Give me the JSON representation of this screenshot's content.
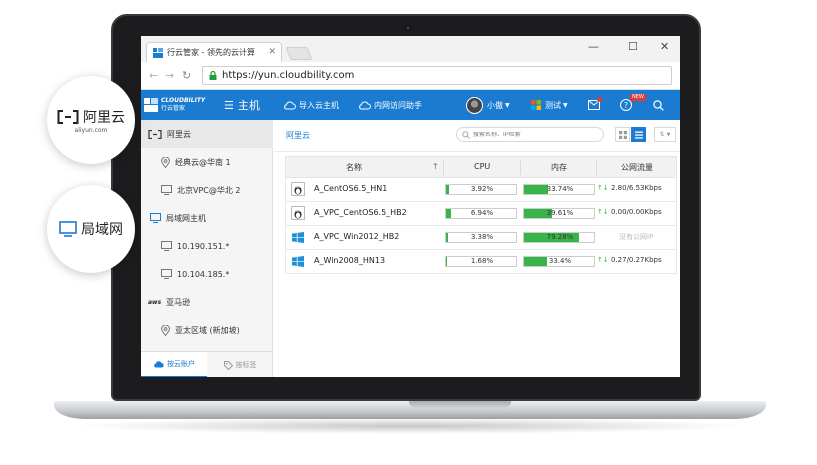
{
  "browser": {
    "tab_title": "行云管家 - 领先的云计算",
    "url": "https://yun.cloudbility.com"
  },
  "header": {
    "logo_en": "CLOUDBILITY",
    "logo_cn": "行云管家",
    "menu_label": "主机",
    "import_label": "导入云主机",
    "intranet_label": "内网访问助手",
    "user_label": "小傲",
    "team_label": "测试",
    "hot_badge": "NEW"
  },
  "sidebar": {
    "items": [
      {
        "label": "阿里云",
        "icon": "aliyun-icon"
      },
      {
        "label": "经典云@华南 1",
        "icon": "location-pin-icon"
      },
      {
        "label": "北京VPC@华北 2",
        "icon": "monitor-icon"
      },
      {
        "label": "局域网主机",
        "icon": "lan-icon"
      },
      {
        "label": "10.190.151.*",
        "icon": "monitor-icon"
      },
      {
        "label": "10.104.185.*",
        "icon": "monitor-icon"
      },
      {
        "label": "亚马逊",
        "icon": "aws-icon"
      },
      {
        "label": "亚太区域 (新加坡)",
        "icon": "location-pin-icon"
      }
    ],
    "tabs": [
      {
        "label": "按云账户",
        "icon": "cloud-icon"
      },
      {
        "label": "按标签",
        "icon": "tag-icon"
      }
    ]
  },
  "main": {
    "breadcrumb": "阿里云",
    "search_placeholder": "搜索名称、IP检索",
    "columns": [
      "名称",
      "CPU",
      "内存",
      "公网流量"
    ],
    "sort_arrow": "↑",
    "rows": [
      {
        "os": "linux",
        "name": "A_CentOS6.5_HN1",
        "cpu_pct": 3.92,
        "cpu_label": "3.92%",
        "mem_pct": 33.74,
        "mem_label": "33.74%",
        "traffic": "2.80/6.53Kbps",
        "muted": false
      },
      {
        "os": "linux",
        "name": "A_VPC_CentOS6.5_HB2",
        "cpu_pct": 6.94,
        "cpu_label": "6.94%",
        "mem_pct": 39.61,
        "mem_label": "39.61%",
        "traffic": "0.00/0.00Kbps",
        "muted": false
      },
      {
        "os": "windows",
        "name": "A_VPC_Win2012_HB2",
        "cpu_pct": 3.38,
        "cpu_label": "3.38%",
        "mem_pct": 79.28,
        "mem_label": "79.28%",
        "traffic": "没有公网IP",
        "muted": true
      },
      {
        "os": "windows",
        "name": "A_Win2008_HN13",
        "cpu_pct": 1.68,
        "cpu_label": "1.68%",
        "mem_pct": 33.4,
        "mem_label": "33.4%",
        "traffic": "0.27/0.27Kbps",
        "muted": false
      }
    ]
  },
  "callouts": {
    "aliyun_title": "阿里云",
    "aliyun_sub": "aliyun.com",
    "lan_title": "局域网"
  },
  "colors": {
    "brand_blue": "#1a7bd0",
    "bar_green": "#38b449"
  }
}
